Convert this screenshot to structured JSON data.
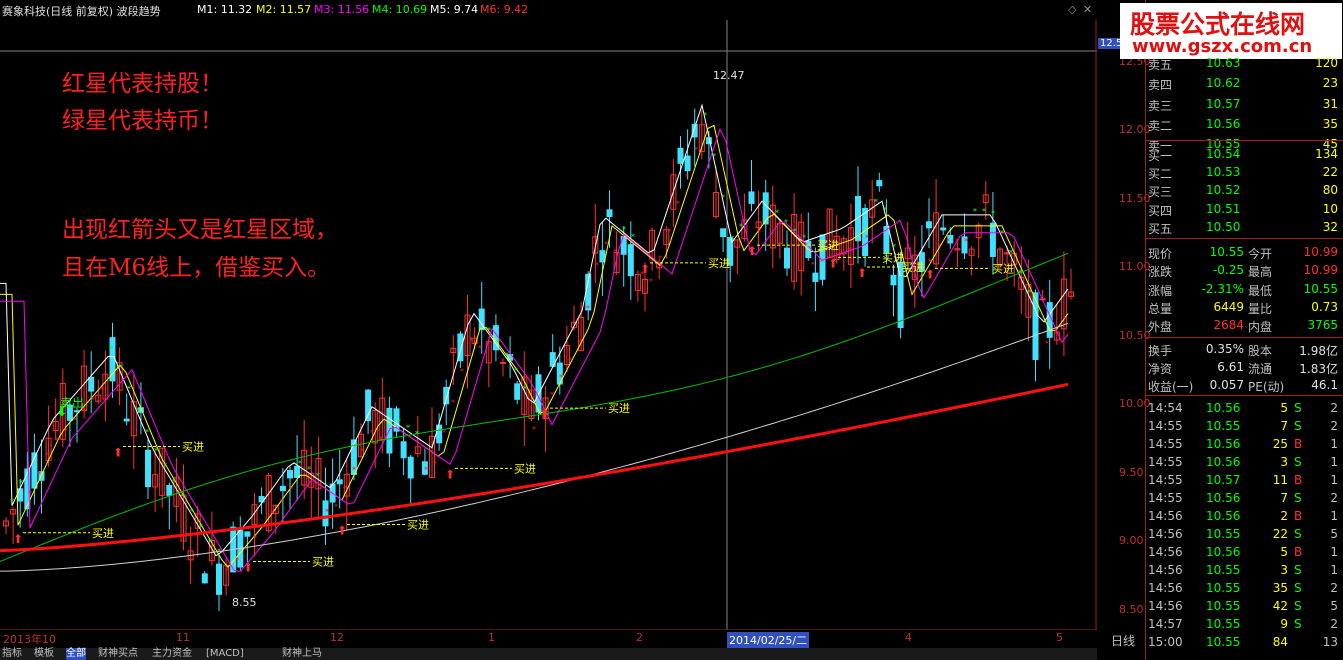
{
  "header": {
    "title": "赛象科技(日线 前复权) 波段趋势",
    "ma": [
      {
        "label": "M1: 11.32",
        "color": "#ffffff"
      },
      {
        "label": "M2: 11.57",
        "color": "#ffff00"
      },
      {
        "label": "M3: 11.56",
        "color": "#ff00ff"
      },
      {
        "label": "M4: 10.69",
        "color": "#00ff00"
      },
      {
        "label": "M5: 9.74",
        "color": "#ffffff"
      },
      {
        "label": "M6: 9.42",
        "color": "#ff0000"
      }
    ]
  },
  "watermark": {
    "line1": "股票公式在线网",
    "line2": "www.gszx.com.cn"
  },
  "annotations": {
    "red_star": "红星代表持股！",
    "green_star": "绿星代表持币！",
    "rule_line1": "出现红箭头又是红星区域，",
    "rule_line2": "且在M6线上，借鉴买入。",
    "sell_label": "卖出",
    "buy_label": "买进",
    "high_label": "12.47",
    "low_label": "8.55",
    "cursor_date": "2014/02/25/二",
    "cursor_price": "12.5"
  },
  "chart_data": {
    "type": "candlestick",
    "yticks": [
      "12.50",
      "12.00",
      "11.50",
      "11.00",
      "10.50",
      "10.00",
      "9.50",
      "9.00",
      "8.50"
    ],
    "xticks": [
      "2013年10",
      "11",
      "12",
      "1",
      "2",
      "3",
      "4",
      "5"
    ],
    "ylim": [
      8.4,
      12.6
    ]
  },
  "quote": {
    "sell": [
      {
        "label": "卖五",
        "price": "10.63",
        "vol": "120"
      },
      {
        "label": "卖四",
        "price": "10.62",
        "vol": "23"
      },
      {
        "label": "卖三",
        "price": "10.57",
        "vol": "31"
      },
      {
        "label": "卖二",
        "price": "10.56",
        "vol": "35"
      },
      {
        "label": "卖一",
        "price": "10.55",
        "vol": "45"
      }
    ],
    "buy": [
      {
        "label": "买一",
        "price": "10.54",
        "vol": "134"
      },
      {
        "label": "买二",
        "price": "10.53",
        "vol": "22"
      },
      {
        "label": "买三",
        "price": "10.52",
        "vol": "80"
      },
      {
        "label": "买四",
        "price": "10.51",
        "vol": "10"
      },
      {
        "label": "买五",
        "price": "10.50",
        "vol": "32"
      }
    ],
    "stats": [
      {
        "l1": "现价",
        "v1": "10.55",
        "c1": "#00ff00",
        "l2": "今开",
        "v2": "10.99",
        "c2": "#ff3030"
      },
      {
        "l1": "涨跌",
        "v1": "-0.25",
        "c1": "#00ff00",
        "l2": "最高",
        "v2": "10.99",
        "c2": "#ff3030"
      },
      {
        "l1": "涨幅",
        "v1": "-2.31%",
        "c1": "#00ff00",
        "l2": "最低",
        "v2": "10.55",
        "c2": "#00ff00"
      },
      {
        "l1": "总量",
        "v1": "6449",
        "c1": "#ffff00",
        "l2": "量比",
        "v2": "0.73",
        "c2": "#ffff00"
      },
      {
        "l1": "外盘",
        "v1": "2684",
        "c1": "#ff3030",
        "l2": "内盘",
        "v2": "3765",
        "c2": "#00ff00"
      }
    ],
    "fin": [
      {
        "l1": "换手",
        "v1": "0.35%",
        "l2": "股本",
        "v2": "1.98亿"
      },
      {
        "l1": "净资",
        "v1": "6.61",
        "l2": "流通",
        "v2": "1.83亿"
      },
      {
        "l1": "收益(一)",
        "v1": "0.057",
        "l2": "PE(动)",
        "v2": "46.1"
      }
    ],
    "ticks": [
      {
        "time": "14:54",
        "price": "10.56",
        "vol": "5",
        "side": "S",
        "n": "2"
      },
      {
        "time": "14:55",
        "price": "10.55",
        "vol": "7",
        "side": "S",
        "n": "2"
      },
      {
        "time": "14:55",
        "price": "10.56",
        "vol": "25",
        "side": "B",
        "n": "1"
      },
      {
        "time": "14:55",
        "price": "10.56",
        "vol": "3",
        "side": "S",
        "n": "1"
      },
      {
        "time": "14:55",
        "price": "10.57",
        "vol": "11",
        "side": "B",
        "n": "1"
      },
      {
        "time": "14:55",
        "price": "10.56",
        "vol": "7",
        "side": "S",
        "n": "2"
      },
      {
        "time": "14:56",
        "price": "10.56",
        "vol": "2",
        "side": "B",
        "n": "1"
      },
      {
        "time": "14:56",
        "price": "10.55",
        "vol": "22",
        "side": "S",
        "n": "5"
      },
      {
        "time": "14:56",
        "price": "10.56",
        "vol": "5",
        "side": "B",
        "n": "1"
      },
      {
        "time": "14:56",
        "price": "10.55",
        "vol": "3",
        "side": "S",
        "n": "1"
      },
      {
        "time": "14:56",
        "price": "10.55",
        "vol": "35",
        "side": "S",
        "n": "2"
      },
      {
        "time": "14:56",
        "price": "10.55",
        "vol": "42",
        "side": "S",
        "n": "5"
      },
      {
        "time": "14:57",
        "price": "10.55",
        "vol": "9",
        "side": "S",
        "n": "2"
      },
      {
        "time": "15:00",
        "price": "10.55",
        "vol": "84",
        "side": "",
        "n": "13"
      }
    ],
    "period": "日线"
  },
  "tabs": [
    "指标",
    "模板",
    "全部",
    "财神买点",
    "主力资金",
    "[MACD]",
    "财神上马"
  ]
}
